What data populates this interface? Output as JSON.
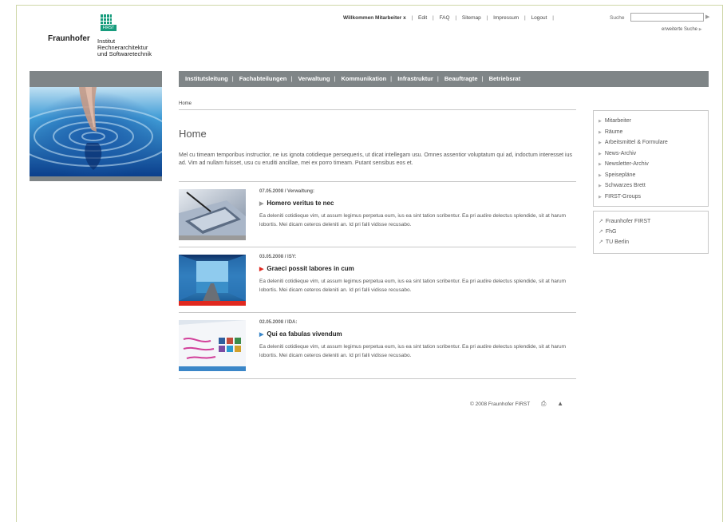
{
  "logo": {
    "badge": "FIRST",
    "brand": "Fraunhofer",
    "institute": "Institut\nRechnerarchitektur\nund Softwaretechnik"
  },
  "topnav": {
    "welcome": "Willkommen Mitarbeiter x",
    "links": [
      "Edit",
      "FAQ",
      "Sitemap",
      "Impressum",
      "Logout"
    ]
  },
  "search": {
    "label": "Suche",
    "value": "",
    "go_icon": "triangle-right-icon",
    "advanced": "erweiterte Suche"
  },
  "mainnav": [
    "Institutsleitung",
    "Fachabteilungen",
    "Verwaltung",
    "Kommunikation",
    "Infrastruktur",
    "Beauftragte",
    "Betriebsrat"
  ],
  "breadcrumb": "Home",
  "page": {
    "title": "Home",
    "intro": "Mel cu timeam temporibus instructior, ne ius ignota cotidieque persequeris, ut dicat intellegam usu. Omnes assentior voluptatum qui ad, indoctum interesset ius ad. Vim ad nullam fuisset, usu cu eruditi ancillae, mei ex porro timeam. Putant sensibus eos et."
  },
  "news": [
    {
      "meta": "07.05.2008 / Verwaltung:",
      "headline": "Homero veritus te nec",
      "arrow_color": "#999999",
      "accent": "#9a9a9a",
      "body": "Ea deleniti cotidieque vim, ut assum legimus perpetua eum, ius ea sint tation scribentur. Ea pri audire delectus splendide, sit at harum lobortis. Mei dicam ceteros deleniti an. Id pri falli vidisse recusabo."
    },
    {
      "meta": "03.05.2008  / ISY:",
      "headline": "Graeci possit labores in cum",
      "arrow_color": "#e0281f",
      "accent": "#e0281f",
      "body": "Ea deleniti cotidieque vim, ut assum legimus perpetua eum, ius ea sint tation scribentur. Ea pri audire delectus splendide, sit at harum lobortis. Mei dicam ceteros deleniti an. Id pri falli vidisse recusabo."
    },
    {
      "meta": "02.05.2008 / IDA:",
      "headline": "Qui ea fabulas vivendum",
      "arrow_color": "#3a86c8",
      "accent": "#3a86c8",
      "body": "Ea deleniti cotidieque vim, ut assum legimus perpetua eum, ius ea sint tation scribentur. Ea pri audire delectus splendide, sit at harum lobortis. Mei dicam ceteros deleniti an. Id pri falli vidisse recusabo."
    }
  ],
  "sidebar": {
    "items": [
      "Mitarbeiter",
      "Räume",
      "Arbeitsmittel & Formulare",
      "News-Archiv",
      "Newsletter-Archiv",
      "Speisepläne",
      "Schwarzes Brett",
      "FIRST-Groups"
    ],
    "links": [
      "Fraunhofer FIRST",
      "FhG",
      "TU Berlin"
    ]
  },
  "footer": {
    "copyright": "© 2008 Fraunhofer FIRST",
    "print_icon": "printer-icon",
    "top_icon": "arrow-up-icon"
  }
}
